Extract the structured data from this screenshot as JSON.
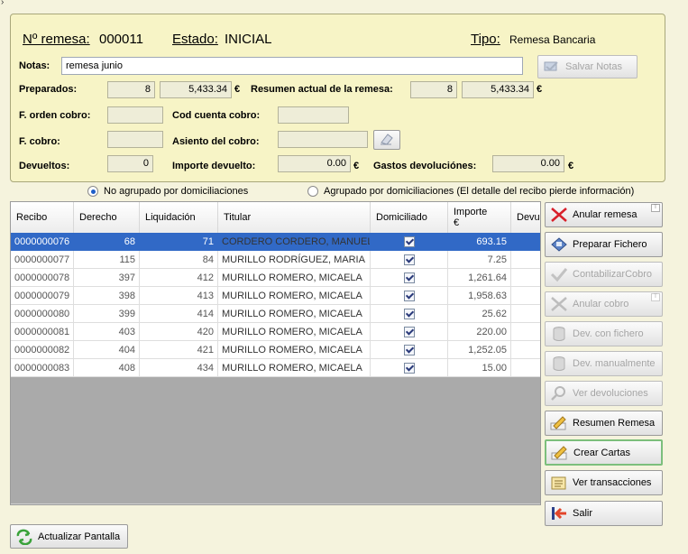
{
  "header": {
    "remesa_label": "Nº remesa:",
    "remesa_value": "000011",
    "estado_label": "Estado:",
    "estado_value": "INICIAL",
    "tipo_label": "Tipo:",
    "tipo_value": "Remesa Bancaria"
  },
  "notas": {
    "label": "Notas:",
    "value": "remesa junio",
    "save_button": "Salvar Notas"
  },
  "fields": {
    "preparados_label": "Preparados:",
    "preparados_count": "8",
    "preparados_amount": "5,433.34",
    "resumen_label": "Resumen actual de la remesa:",
    "resumen_count": "8",
    "resumen_amount": "5,433.34",
    "f_orden_label": "F. orden cobro:",
    "cod_cuenta_label": "Cod cuenta cobro:",
    "f_cobro_label": "F. cobro:",
    "asiento_label": "Asiento del cobro:",
    "devueltos_label": "Devueltos:",
    "devueltos_value": "0",
    "importe_devuelto_label": "Importe devuelto:",
    "importe_devuelto_value": "0.00",
    "gastos_label": "Gastos devoluciónes:",
    "gastos_value": "0.00",
    "currency": "€"
  },
  "grouping": {
    "option1": "No agrupado por domiciliaciones",
    "option2": "Agrupado por domiciliaciones (El detalle del recibo pierde información)"
  },
  "table": {
    "columns": [
      "Recibo",
      "Derecho",
      "Liquidación",
      "Titular",
      "Domiciliado",
      "Importe",
      "€",
      "Devu"
    ],
    "rows": [
      {
        "recibo": "0000000076",
        "derecho": "68",
        "liquidacion": "71",
        "titular": "CORDERO CORDERO, MANUEL",
        "importe": "693.15"
      },
      {
        "recibo": "0000000077",
        "derecho": "115",
        "liquidacion": "84",
        "titular": "MURILLO RODRÍGUEZ, MARIA",
        "importe": "7.25"
      },
      {
        "recibo": "0000000078",
        "derecho": "397",
        "liquidacion": "412",
        "titular": "MURILLO ROMERO, MICAELA",
        "importe": "1,261.64"
      },
      {
        "recibo": "0000000079",
        "derecho": "398",
        "liquidacion": "413",
        "titular": "MURILLO ROMERO, MICAELA",
        "importe": "1,958.63"
      },
      {
        "recibo": "0000000080",
        "derecho": "399",
        "liquidacion": "414",
        "titular": "MURILLO ROMERO, MICAELA",
        "importe": "25.62"
      },
      {
        "recibo": "0000000081",
        "derecho": "403",
        "liquidacion": "420",
        "titular": "MURILLO ROMERO, MICAELA",
        "importe": "220.00"
      },
      {
        "recibo": "0000000082",
        "derecho": "404",
        "liquidacion": "421",
        "titular": "MURILLO ROMERO, MICAELA",
        "importe": "1,252.05"
      },
      {
        "recibo": "0000000083",
        "derecho": "408",
        "liquidacion": "434",
        "titular": "MURILLO ROMERO, MICAELA",
        "importe": "15.00"
      }
    ]
  },
  "actions": {
    "anular_remesa": "Anular remesa",
    "preparar_fichero": "Preparar Fichero",
    "contabilizar_cobro": "ContabilizarCobro",
    "anular_cobro": "Anular cobro",
    "dev_con_fichero": "Dev. con fichero",
    "dev_manualmente": "Dev. manualmente",
    "ver_devoluciones": "Ver devoluciones",
    "resumen_remesa": "Resumen Remesa",
    "crear_cartas": "Crear Cartas",
    "ver_transacciones": "Ver transacciones",
    "salir": "Salir",
    "actualizar_pantalla": "Actualizar Pantalla"
  }
}
